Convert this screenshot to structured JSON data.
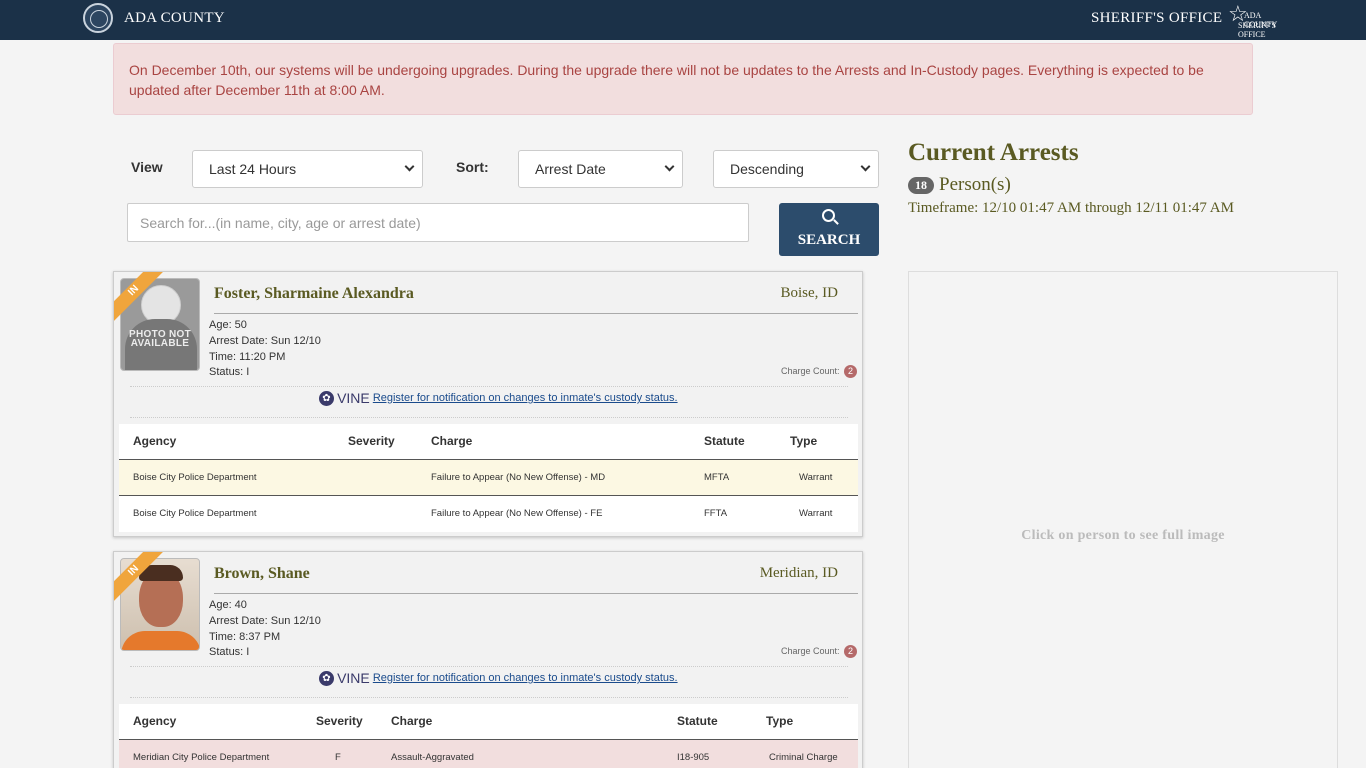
{
  "header": {
    "county": "ADA COUNTY",
    "office": "SHERIFF'S OFFICE",
    "logo_line1": "ADA COUNTY",
    "logo_line2": "SHERIFF'S OFFICE"
  },
  "alert": {
    "text": "On December 10th, our systems will be undergoing upgrades. During the upgrade there will not be updates to the Arrests and In-Custody pages. Everything is expected to be updated after December 11th at 8:00 AM."
  },
  "filters": {
    "view_label": "View",
    "view_value": "Last 24 Hours",
    "sort_label": "Sort:",
    "sort_value": "Arrest Date",
    "order_value": "Descending",
    "search_placeholder": "Search for...(in name, city, age or arrest date)",
    "search_button": "SEARCH"
  },
  "summary": {
    "title": "Current Arrests",
    "count": "18",
    "count_label": "Person(s)",
    "timeframe": "Timeframe: 12/10 01:47 AM through 12/11 01:47 AM",
    "preview_text": "Click on person to see full image"
  },
  "table_headers": {
    "agency": "Agency",
    "severity": "Severity",
    "charge": "Charge",
    "statute": "Statute",
    "type": "Type"
  },
  "vine": {
    "word": "VINE",
    "link": " Register for notification on changes to inmate's custody status."
  },
  "arrests": [
    {
      "badge": "IN",
      "name": "Foster, Sharmaine Alexandra",
      "city": "Boise, ID",
      "photo_text": "PHOTO NOT AVAILABLE",
      "age": "Age: 50",
      "arrest_date": "Arrest Date: Sun 12/10",
      "time": "Time: 11:20 PM",
      "status": "Status: I",
      "charge_count_label": "Charge Count:",
      "charge_count": "2",
      "charges": [
        {
          "agency": "Boise City Police Department",
          "severity": "",
          "charge": "Failure to Appear (No New Offense) - MD",
          "statute": "MFTA",
          "type": "Warrant",
          "bg": "#fcf8e3"
        },
        {
          "agency": "Boise City Police Department",
          "severity": "",
          "charge": "Failure to Appear (No New Offense) - FE",
          "statute": "FFTA",
          "type": "Warrant",
          "bg": "#ffffff"
        }
      ]
    },
    {
      "badge": "IN",
      "name": "Brown, Shane",
      "city": "Meridian, ID",
      "age": "Age: 40",
      "arrest_date": "Arrest Date: Sun 12/10",
      "time": "Time: 8:37 PM",
      "status": "Status: I",
      "charge_count_label": "Charge Count:",
      "charge_count": "2",
      "charges": [
        {
          "agency": "Meridian City Police Department",
          "severity": "F",
          "charge": "Assault-Aggravated",
          "statute": "I18-905",
          "type": "Criminal Charge",
          "bg": "#f2dede"
        }
      ]
    }
  ]
}
